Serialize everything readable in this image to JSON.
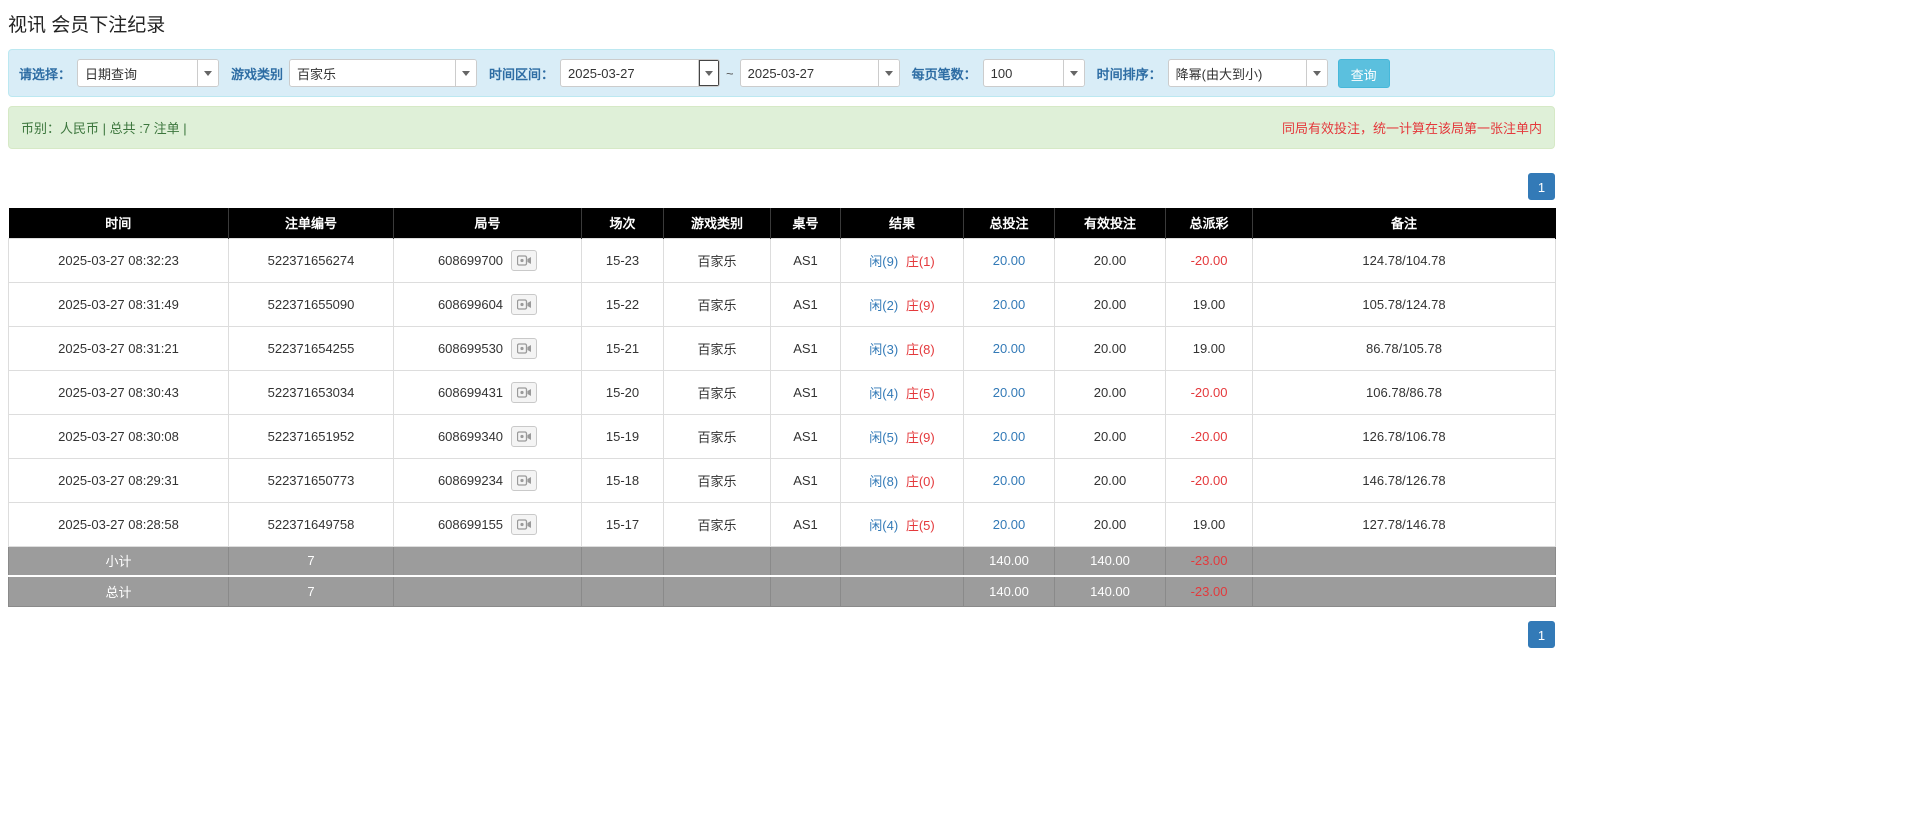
{
  "page": {
    "title": "视讯 会员下注纪录"
  },
  "colors": {
    "accent_blue": "#337ab7",
    "label_blue": "#2e6da4",
    "player_blue": "#337ab7",
    "banker_red": "#e4393c",
    "negative_red": "#e4393c",
    "info_bg": "#d9edf7",
    "info_border": "#bce8f1",
    "success_bg": "#dff0d8",
    "success_text": "#3c763d",
    "header_bg": "#000000",
    "footer_bg": "#9c9c9c",
    "button_info": "#5bc0de"
  },
  "filters": {
    "select_label": "请选择：",
    "select_value": "日期查询",
    "game_type_label": "游戏类别",
    "game_type_value": "百家乐",
    "time_range_label": "时间区间：",
    "time_from": "2025-03-27",
    "tilde": "~",
    "time_to": "2025-03-27",
    "page_size_label": "每页笔数：",
    "page_size_value": "100",
    "sort_label": "时间排序：",
    "sort_value": "降幂(由大到小)",
    "search_button": "查询"
  },
  "summary": {
    "currency_info": "币别：人民币 | 总共 :7 注单 |",
    "notice": "同局有效投注，统一计算在该局第一张注单内"
  },
  "pagination": {
    "page": "1"
  },
  "table": {
    "headers": [
      "时间",
      "注单编号",
      "局号",
      "场次",
      "游戏类别",
      "桌号",
      "结果",
      "总投注",
      "有效投注",
      "总派彩",
      "备注"
    ],
    "rows": [
      {
        "time": "2025-03-27 08:32:23",
        "bet_id": "522371656274",
        "round_id": "608699700",
        "session": "15-23",
        "game_type": "百家乐",
        "table_no": "AS1",
        "result_player": "闲(9)",
        "result_banker": "庄(1)",
        "total_bet": "20.00",
        "valid_bet": "20.00",
        "payout": "-20.00",
        "remark": "124.78/104.78"
      },
      {
        "time": "2025-03-27 08:31:49",
        "bet_id": "522371655090",
        "round_id": "608699604",
        "session": "15-22",
        "game_type": "百家乐",
        "table_no": "AS1",
        "result_player": "闲(2)",
        "result_banker": "庄(9)",
        "total_bet": "20.00",
        "valid_bet": "20.00",
        "payout": "19.00",
        "remark": "105.78/124.78"
      },
      {
        "time": "2025-03-27 08:31:21",
        "bet_id": "522371654255",
        "round_id": "608699530",
        "session": "15-21",
        "game_type": "百家乐",
        "table_no": "AS1",
        "result_player": "闲(3)",
        "result_banker": "庄(8)",
        "total_bet": "20.00",
        "valid_bet": "20.00",
        "payout": "19.00",
        "remark": "86.78/105.78"
      },
      {
        "time": "2025-03-27 08:30:43",
        "bet_id": "522371653034",
        "round_id": "608699431",
        "session": "15-20",
        "game_type": "百家乐",
        "table_no": "AS1",
        "result_player": "闲(4)",
        "result_banker": "庄(5)",
        "total_bet": "20.00",
        "valid_bet": "20.00",
        "payout": "-20.00",
        "remark": "106.78/86.78"
      },
      {
        "time": "2025-03-27 08:30:08",
        "bet_id": "522371651952",
        "round_id": "608699340",
        "session": "15-19",
        "game_type": "百家乐",
        "table_no": "AS1",
        "result_player": "闲(5)",
        "result_banker": "庄(9)",
        "total_bet": "20.00",
        "valid_bet": "20.00",
        "payout": "-20.00",
        "remark": "126.78/106.78"
      },
      {
        "time": "2025-03-27 08:29:31",
        "bet_id": "522371650773",
        "round_id": "608699234",
        "session": "15-18",
        "game_type": "百家乐",
        "table_no": "AS1",
        "result_player": "闲(8)",
        "result_banker": "庄(0)",
        "total_bet": "20.00",
        "valid_bet": "20.00",
        "payout": "-20.00",
        "remark": "146.78/126.78"
      },
      {
        "time": "2025-03-27 08:28:58",
        "bet_id": "522371649758",
        "round_id": "608699155",
        "session": "15-17",
        "game_type": "百家乐",
        "table_no": "AS1",
        "result_player": "闲(4)",
        "result_banker": "庄(5)",
        "total_bet": "20.00",
        "valid_bet": "20.00",
        "payout": "19.00",
        "remark": "127.78/146.78"
      }
    ],
    "subtotal": {
      "label": "小计",
      "count": "7",
      "total_bet": "140.00",
      "valid_bet": "140.00",
      "payout": "-23.00",
      "remark": ""
    },
    "total": {
      "label": "总计",
      "count": "7",
      "total_bet": "140.00",
      "valid_bet": "140.00",
      "payout": "-23.00",
      "remark": ""
    }
  }
}
